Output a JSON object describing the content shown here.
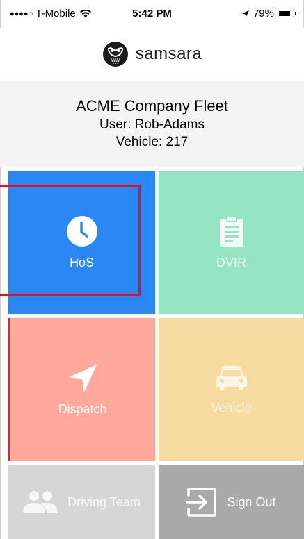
{
  "status_bar": {
    "signal_dots": "●●●●○",
    "carrier": "T-Mobile",
    "wifi_icon": "wifi-icon",
    "time": "5:42 PM",
    "location_icon": "location-arrow-icon",
    "battery_percent": "79%",
    "battery_level": 0.79
  },
  "header": {
    "logo_icon": "owl-logo-icon",
    "brand": "samsara"
  },
  "fleet": {
    "name": "ACME Company Fleet",
    "user": "User: Rob-Adams",
    "vehicle": "Vehicle: 217"
  },
  "tiles": {
    "hos": {
      "label": "HoS",
      "icon": "clock-icon",
      "color": "#2b87f4"
    },
    "dvir": {
      "label": "DVIR",
      "icon": "clipboard-icon",
      "color": "#95e4c6"
    },
    "dispatch": {
      "label": "Dispatch",
      "icon": "navigation-arrow-icon",
      "color": "#fea99c"
    },
    "vehicle": {
      "label": "Vehicle",
      "icon": "car-icon",
      "color": "#f7dca2"
    },
    "driving_team": {
      "label": "Driving Team",
      "icon": "people-icon",
      "color": "#d6d6d6"
    },
    "sign_out": {
      "label": "Sign Out",
      "icon": "sign-out-icon",
      "color": "#a9a9a9"
    }
  },
  "highlight_color": "#e3121b"
}
